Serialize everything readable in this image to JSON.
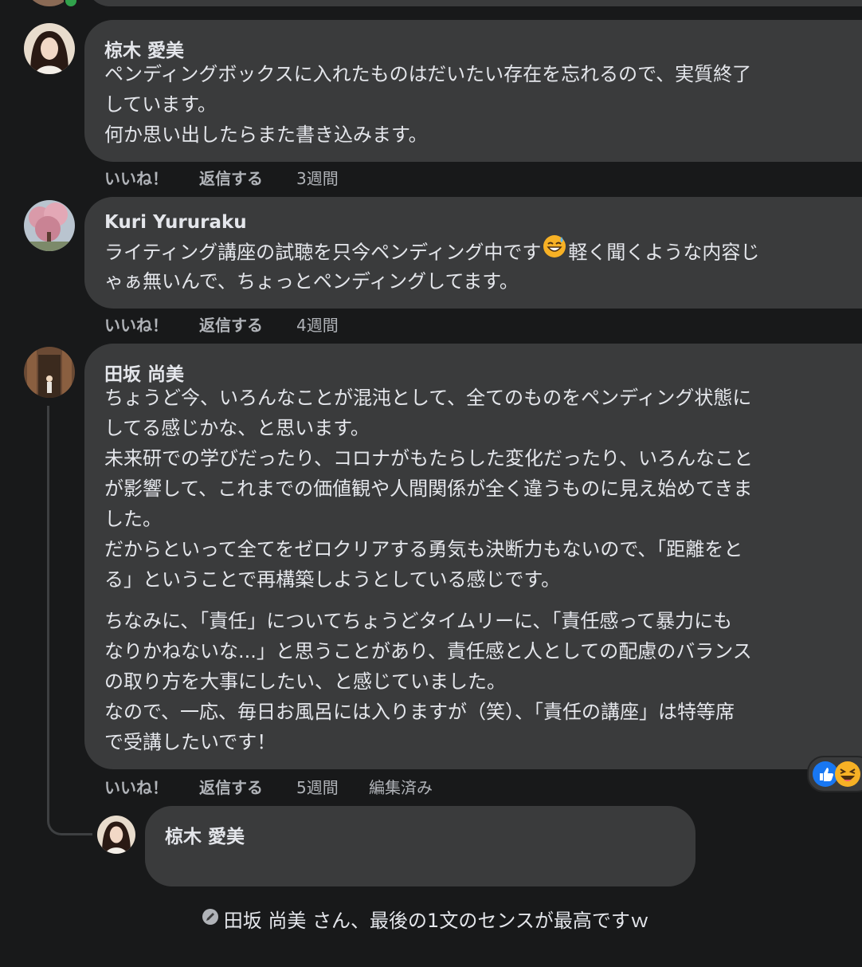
{
  "comments": [
    {
      "author": "椋木 愛美",
      "lines": [
        "ペンディングボックスに入れたものはだいたい存在を忘れるので、実質終了",
        "しています。",
        "何か思い出したらまた書き込みます。"
      ],
      "like": "いいね！",
      "reply": "返信する",
      "time": "3週間"
    },
    {
      "author": "Kuri Yururaku",
      "line1_before": "ライティング講座の試聴を只今ペンディング中です",
      "line1_emoji": "grinning-sweat-emoji",
      "line1_after": "軽く聞くような内容じ",
      "line2": "ゃぁ無いんで、ちょっとペンディングしてます。",
      "like": "いいね！",
      "reply": "返信する",
      "time": "4週間"
    },
    {
      "author": "田坂 尚美",
      "para1": [
        "ちょうど今、いろんなことが混沌として、全てのものをペンディング状態に",
        "してる感じかな、と思います。",
        "未来研での学びだったり、コロナがもたらした変化だったり、いろんなこと",
        "が影響して、これまでの価値観や人間関係が全く違うものに見え始めてきま",
        "した。",
        "だからといって全てをゼロクリアする勇気も決断力もないので、「距離をと",
        "る」ということで再構築しようとしている感じです。"
      ],
      "para2": [
        "ちなみに、「責任」についてちょうどタイムリーに、「責任感って暴力にも",
        "なりかねないな...」と思うことがあり、責任感と人としての配慮のバランス",
        "の取り方を大事にしたい、と感じていました。",
        "なので、一応、毎日お風呂には入りますが（笑）、「責任の講座」は特等席",
        "で受講したいです！"
      ],
      "like": "いいね！",
      "reply": "返信する",
      "time": "5週間",
      "edited": "編集済み",
      "reactions": [
        "like-reaction-icon",
        "haha-reaction-icon"
      ]
    }
  ],
  "reply": {
    "author": "椋木 愛美",
    "mention": "田坂 尚美",
    "text": " さん、最後の1文のセンスが最高ですｗ"
  },
  "colors": {
    "background": "#18191a",
    "bubble": "#3a3b3c",
    "text": "#e4e6eb",
    "muted": "#b0b3b8",
    "like_blue": "#1877f2",
    "haha_yellow": "#f7b125"
  }
}
